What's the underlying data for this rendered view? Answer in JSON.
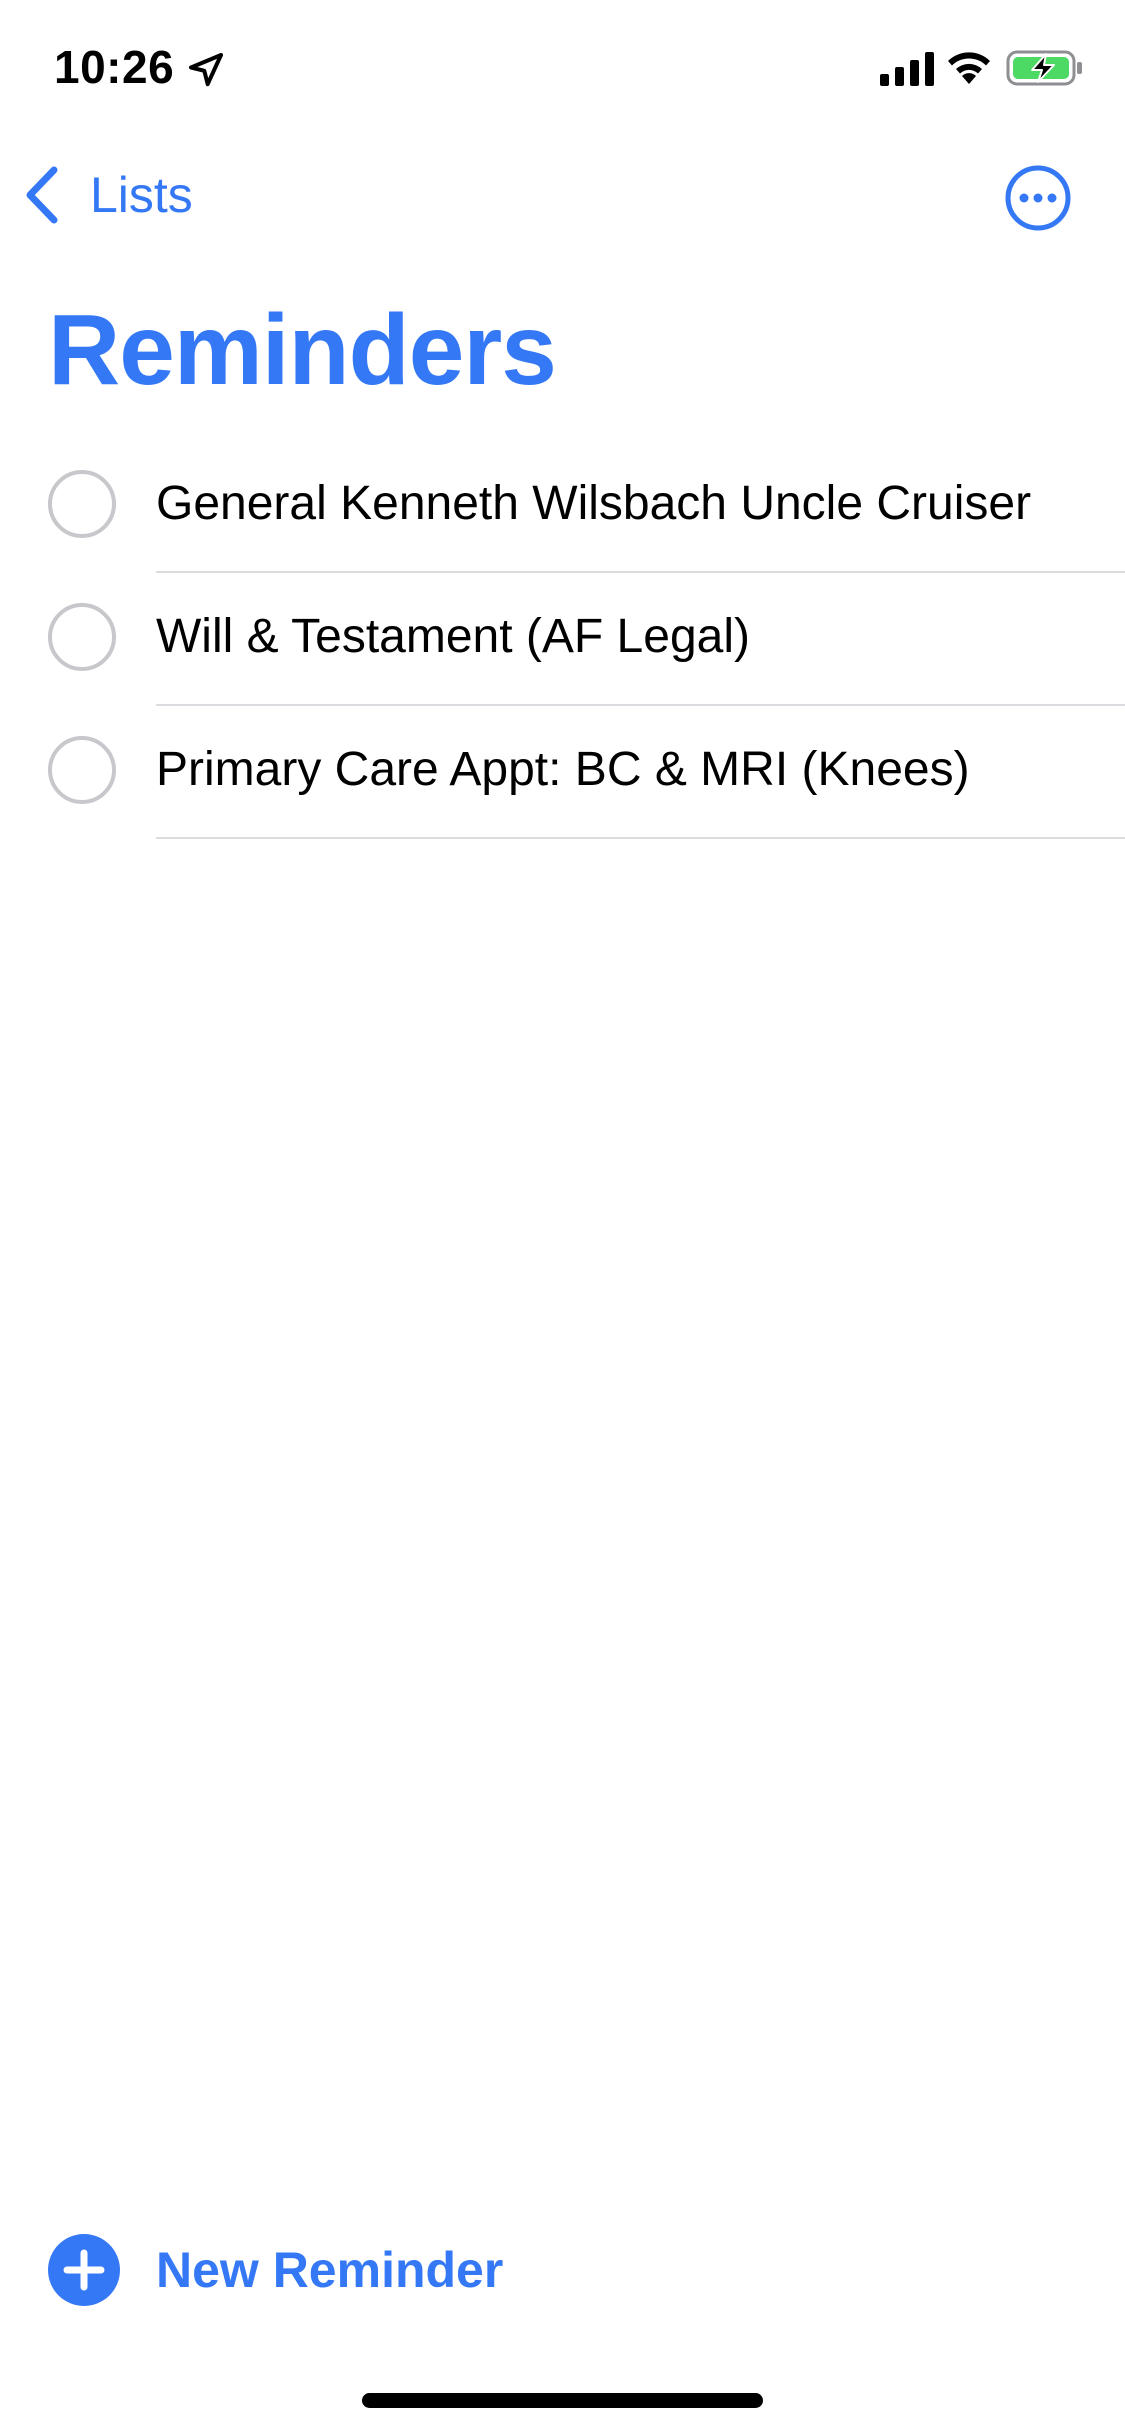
{
  "status_bar": {
    "time": "10:26",
    "location_icon": "location-arrow-icon",
    "signal_icon": "cellular-signal-icon",
    "wifi_icon": "wifi-icon",
    "battery_icon": "battery-charging-icon",
    "battery_color": "#4cd964"
  },
  "nav": {
    "back_label": "Lists",
    "back_icon": "chevron-left-icon",
    "more_icon": "ellipsis-circle-icon"
  },
  "title": "Reminders",
  "reminders": [
    {
      "text": "General Kenneth Wilsbach Uncle Cruiser"
    },
    {
      "text": "Will & Testament (AF Legal)"
    },
    {
      "text": "Primary Care Appt: BC & MRI (Knees)"
    }
  ],
  "new_reminder": {
    "label": "New Reminder",
    "icon": "plus-circle-icon"
  },
  "colors": {
    "accent": "#3478f6",
    "checkbox_border": "#c7c7cc",
    "divider": "#dcdce0"
  }
}
